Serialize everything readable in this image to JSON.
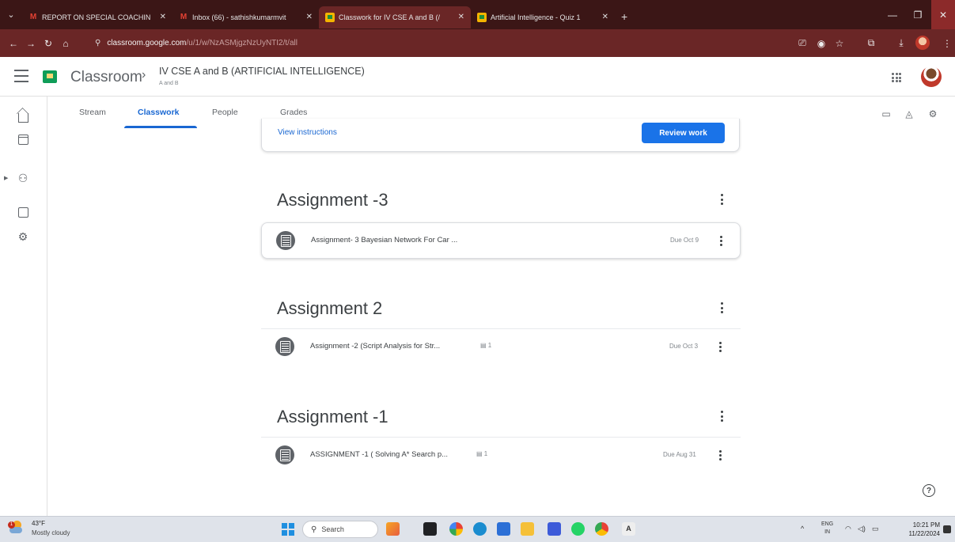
{
  "browser": {
    "tabs": [
      {
        "title": "REPORT ON SPECIAL COACHIN",
        "icon": "gmail-icon",
        "active": false
      },
      {
        "title": "Inbox (66) - sathishkumarmvit",
        "icon": "gmail-icon",
        "active": false
      },
      {
        "title": "Classwork for IV CSE A and B (/",
        "icon": "classroom-icon",
        "active": true
      },
      {
        "title": "Artificial Intelligence - Quiz 1",
        "icon": "classroom-icon",
        "active": false
      }
    ],
    "url_host": "classroom.google.com",
    "url_path": "/u/1/w/NzASMjgzNzUyNTI2/t/all"
  },
  "header": {
    "app_name": "Classroom",
    "course_title": "IV CSE A and B (ARTIFICIAL INTELLIGENCE)",
    "course_section": "A and B"
  },
  "nav_tabs": [
    "Stream",
    "Classwork",
    "People",
    "Grades"
  ],
  "active_tab": "Classwork",
  "instructions_card": {
    "link": "View instructions",
    "button": "Review work"
  },
  "topics": [
    {
      "title": "Assignment -3",
      "assignments": [
        {
          "title": "Assignment- 3 Bayesian Network For Car ...",
          "attachments": "",
          "due": "Due Oct 9"
        }
      ]
    },
    {
      "title": "Assignment 2",
      "assignments": [
        {
          "title": "Assignment -2 (Script Analysis for Str...",
          "attachments": "1",
          "due": "Due Oct 3"
        }
      ]
    },
    {
      "title": "Assignment -1",
      "assignments": [
        {
          "title": "ASSIGNMENT -1 ( Solving A* Search p...",
          "attachments": "1",
          "due": "Due Aug 31"
        }
      ]
    }
  ],
  "taskbar": {
    "weather_temp": "43°F",
    "weather_desc": "Mostly cloudy",
    "search_label": "Search",
    "lang_top": "ENG",
    "lang_bottom": "IN",
    "time": "10:21 PM",
    "date": "11/22/2024"
  },
  "colors": {
    "accent": "#1967d2",
    "button": "#1a73e8",
    "browser_frame": "#6a2626"
  }
}
